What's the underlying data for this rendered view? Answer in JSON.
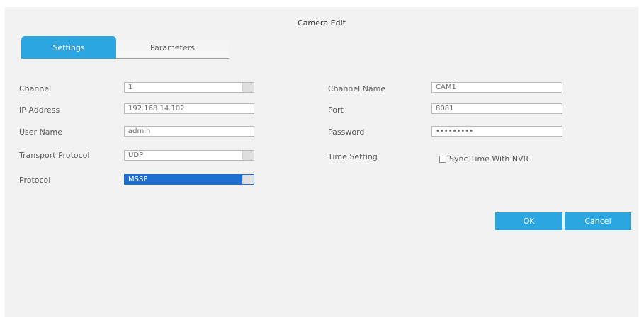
{
  "dialog": {
    "title": "Camera Edit"
  },
  "tabs": [
    {
      "label": "Settings",
      "active": true
    },
    {
      "label": "Parameters",
      "active": false
    }
  ],
  "left_fields": [
    {
      "label": "Channel",
      "value": "1"
    },
    {
      "label": "IP Address",
      "value": "192.168.14.102"
    },
    {
      "label": "User Name",
      "value": "admin"
    },
    {
      "label": "Transport Protocol",
      "value": "UDP"
    },
    {
      "label": "Protocol",
      "value": "MSSP"
    }
  ],
  "right_fields": [
    {
      "label": "Channel Name",
      "value": "CAM1"
    },
    {
      "label": "Port",
      "value": "8081"
    },
    {
      "label": "Password",
      "value": "•••••••••"
    },
    {
      "label": "Time Setting",
      "checkbox_label": "Sync Time With NVR",
      "checked": false
    }
  ],
  "buttons": {
    "ok": "OK",
    "cancel": "Cancel"
  },
  "colors": {
    "accent": "#2ba6e0",
    "selection": "#1f6fd0",
    "panel": "#f2f2f2"
  }
}
